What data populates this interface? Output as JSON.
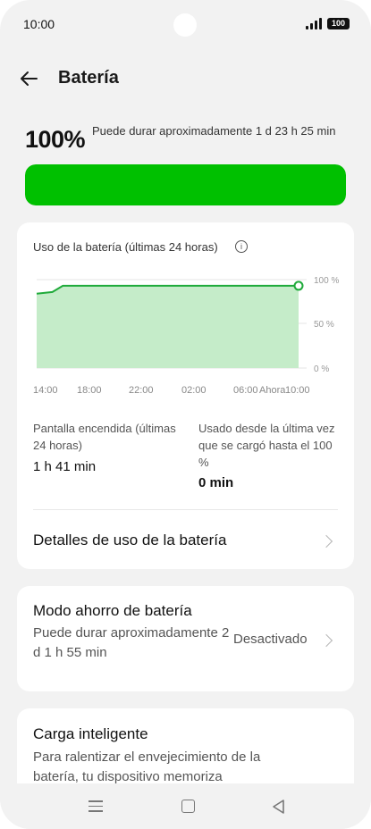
{
  "status_bar": {
    "time": "10:00",
    "battery_level": "100"
  },
  "header": {
    "title": "Batería"
  },
  "battery": {
    "percent_text": "100%",
    "estimate": "Puede durar aproximadamente 1 d 23 h 25 min",
    "level": 1.0,
    "bar_color": "#00c000"
  },
  "usage_card": {
    "title": "Uso de la batería (últimas 24 horas)",
    "info_icon": "i",
    "screen_on_label": "Pantalla encendida (últimas 24 horas)",
    "screen_on_value": "1 h 41 min",
    "since_full_label": "Usado desde la última vez que se cargó hasta el 100 %",
    "since_full_value": "0 min",
    "details_label": "Detalles de uso de la batería"
  },
  "chart_data": {
    "type": "area",
    "x_ticks": [
      "14:00",
      "18:00",
      "22:00",
      "02:00",
      "06:00",
      "Ahora",
      "10:00"
    ],
    "y_ticks": [
      "100 %",
      "50 %",
      "0 %"
    ],
    "ylim": [
      0,
      100
    ],
    "series": [
      {
        "values": [
          [
            0,
            84
          ],
          [
            0.06,
            86
          ],
          [
            0.1,
            93
          ],
          [
            0.13,
            93
          ],
          [
            1,
            93
          ]
        ]
      }
    ],
    "line_color": "#1faa3a",
    "fill_color": "#c5ecc9"
  },
  "saver_card": {
    "title": "Modo ahorro de batería",
    "description": "Puede durar aproximadamente 2 d 1 h 55 min",
    "state": "Desactivado"
  },
  "smart_charge_card": {
    "title": "Carga inteligente",
    "description": "Para ralentizar el envejecimiento de la batería, tu dispositivo memoriza"
  }
}
